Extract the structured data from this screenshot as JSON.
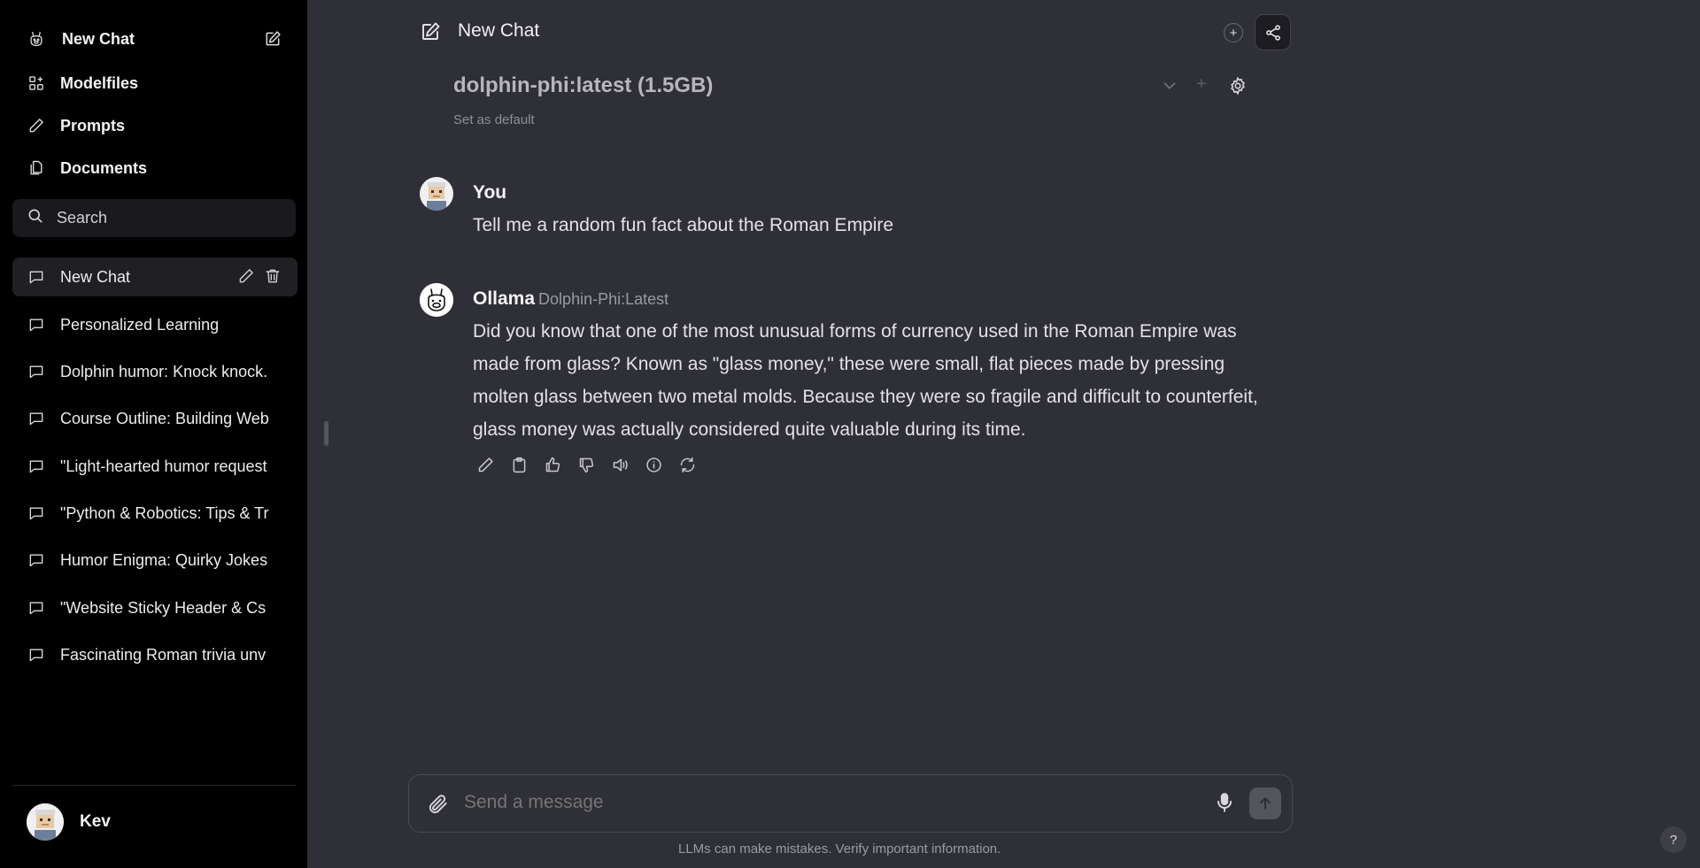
{
  "sidebar": {
    "new_chat_label": "New Chat",
    "nav": [
      {
        "label": "Modelfiles",
        "icon": "grid-icon"
      },
      {
        "label": "Prompts",
        "icon": "pencil-icon"
      },
      {
        "label": "Documents",
        "icon": "documents-icon"
      }
    ],
    "search_placeholder": "Search",
    "chats": [
      {
        "label": "New Chat",
        "active": true
      },
      {
        "label": "Personalized Learning"
      },
      {
        "label": "Dolphin humor: Knock knock."
      },
      {
        "label": "Course Outline: Building Web"
      },
      {
        "label": "\"Light-hearted humor request"
      },
      {
        "label": "\"Python & Robotics: Tips & Tr"
      },
      {
        "label": "Humor Enigma: Quirky Jokes"
      },
      {
        "label": "\"Website Sticky Header & Cs"
      },
      {
        "label": "Fascinating Roman trivia unv"
      }
    ],
    "user_name": "Kev"
  },
  "header": {
    "title": "New Chat",
    "model": "dolphin-phi:latest (1.5GB)",
    "set_default": "Set as default"
  },
  "messages": [
    {
      "author": "You",
      "text": "Tell me a random fun fact about the Roman Empire"
    },
    {
      "author": "Ollama",
      "model": "Dolphin-Phi:Latest",
      "lines": [
        "Did you know that one of the most unusual forms of currency used in the Roman Empire was",
        "made from glass? Known as \"glass money,\" these were small, flat pieces made by pressing",
        "molten glass between two metal molds. Because they were so fragile and difficult to counterfeit,",
        "glass money was actually considered quite valuable during its time."
      ]
    }
  ],
  "composer": {
    "placeholder": "Send a message",
    "disclaimer": "LLMs can make mistakes. Verify important information."
  },
  "help_label": "?",
  "colors": {
    "sidebar_bg": "#000000",
    "main_bg": "#2f2f37",
    "active_chat_bg": "#1f1f24"
  }
}
